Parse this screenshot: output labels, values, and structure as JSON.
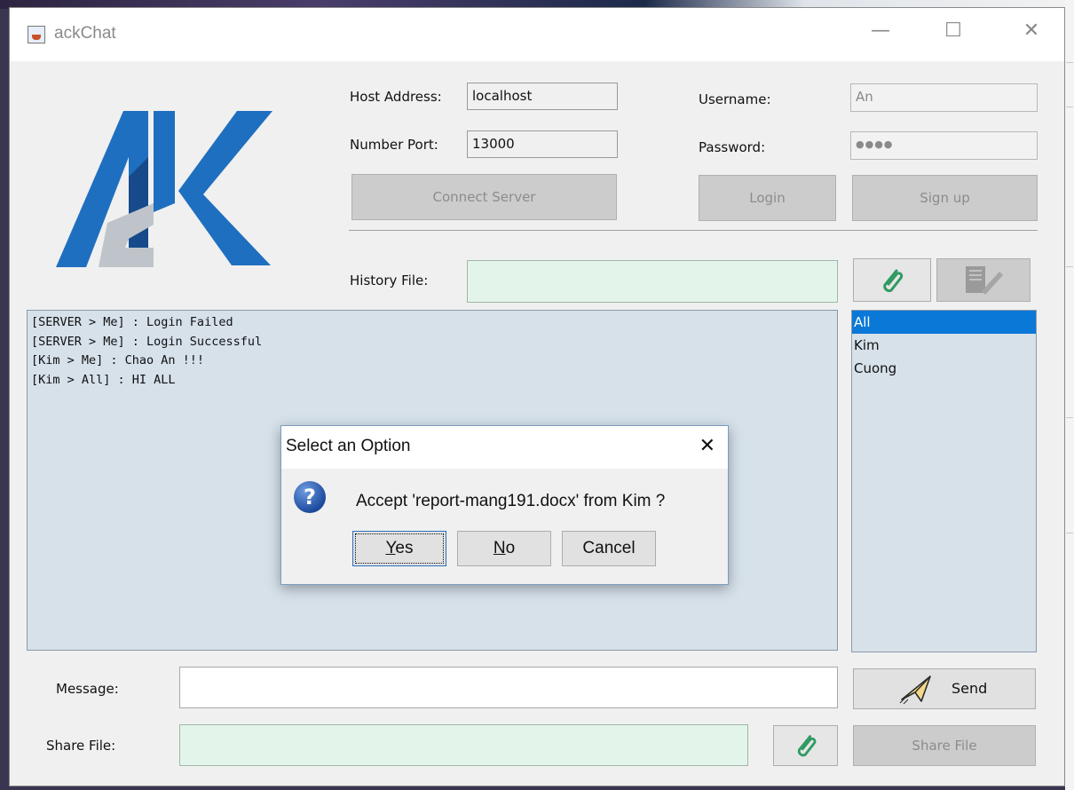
{
  "window": {
    "title": "ackChat"
  },
  "window_controls": {
    "minimize": "—",
    "maximize": "☐",
    "close": "✕"
  },
  "logo": {
    "alt": "AK logo",
    "colors": {
      "blue": "#1f6fc0",
      "dark_blue": "#164a8a",
      "grey": "#bfc4ca"
    }
  },
  "connection": {
    "host_label": "Host Address:",
    "host_value": "localhost",
    "port_label": "Number Port:",
    "port_value": "13000",
    "connect_button": "Connect Server"
  },
  "auth": {
    "username_label": "Username:",
    "username_value": "An",
    "password_label": "Password:",
    "password_value": "●●●●",
    "login_button": "Login",
    "signup_button": "Sign up"
  },
  "history": {
    "label": "History File:",
    "value": "",
    "attach_icon": "paperclip-icon",
    "edit_icon": "document-edit-icon"
  },
  "chat": {
    "lines": [
      "[SERVER > Me] : Login Failed",
      "[SERVER > Me] : Login Successful",
      "[Kim > Me] : Chao An !!!",
      "[Kim > All] : HI ALL"
    ]
  },
  "users": {
    "items": [
      "All",
      "Kim",
      "Cuong"
    ],
    "selected": "All"
  },
  "message": {
    "label": "Message:",
    "value": "",
    "send_button": "Send",
    "send_icon": "paper-plane-icon"
  },
  "share": {
    "label": "Share File:",
    "value": "",
    "attach_icon": "paperclip-icon",
    "share_button": "Share File"
  },
  "dialog": {
    "title": "Select an Option",
    "close": "✕",
    "icon": "question-icon",
    "icon_glyph": "?",
    "message": "Accept 'report-mang191.docx' from Kim ?",
    "buttons": {
      "yes_mnemonic": "Y",
      "yes_rest": "es",
      "no_mnemonic": "N",
      "no_rest": "o",
      "cancel": "Cancel"
    }
  },
  "colors": {
    "panel_bg": "#d6e1ea",
    "file_field_bg": "#e3f5ea",
    "selection": "#0a78d7",
    "disabled_button": "#cccccc"
  }
}
